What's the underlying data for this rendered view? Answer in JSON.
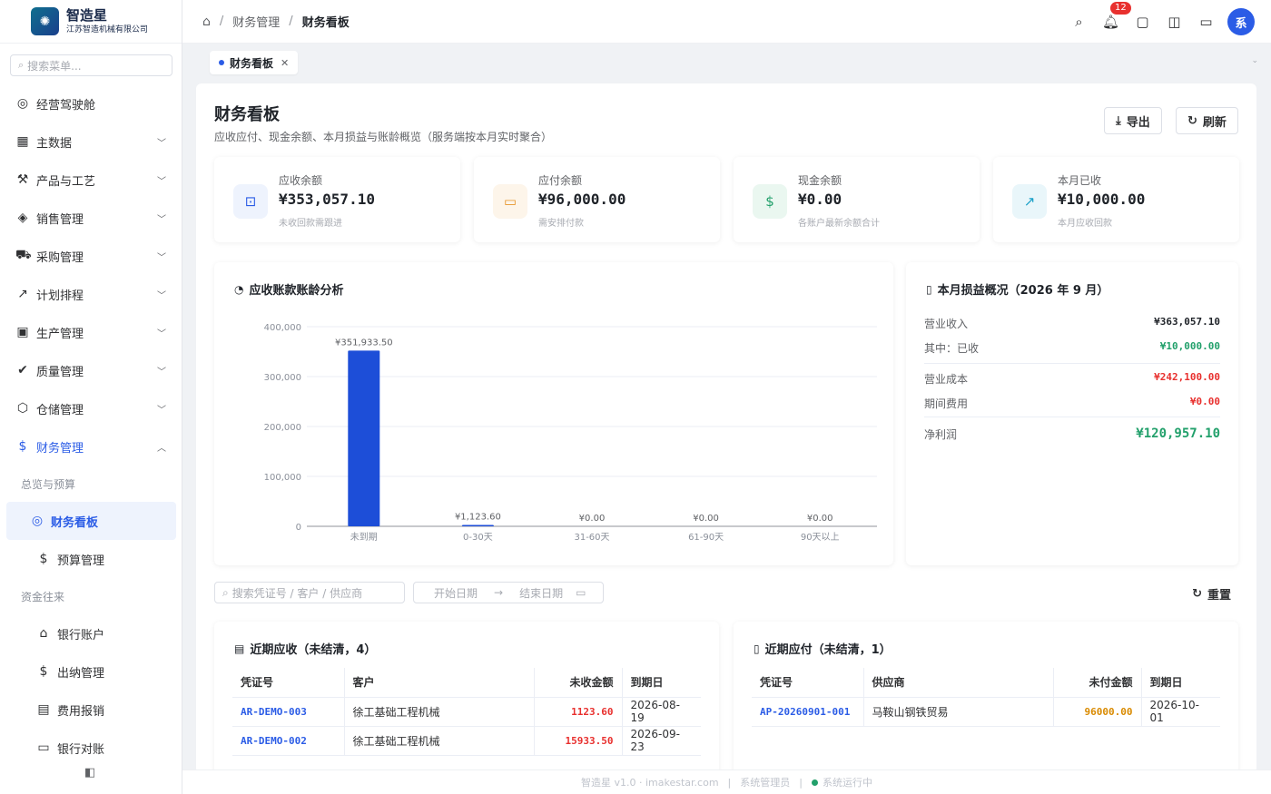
{
  "brand": {
    "name": "智造星",
    "company": "江苏智造机械有限公司"
  },
  "sidebar": {
    "search_placeholder": "搜索菜单...",
    "items": [
      {
        "label": "经营驾驶舱",
        "icon": "gauge-icon",
        "glyph": "◎"
      },
      {
        "label": "主数据",
        "icon": "grid-icon",
        "glyph": "▦"
      },
      {
        "label": "产品与工艺",
        "icon": "tool-icon",
        "glyph": "⚒"
      },
      {
        "label": "销售管理",
        "icon": "tag-icon",
        "glyph": "◈"
      },
      {
        "label": "采购管理",
        "icon": "cart-icon",
        "glyph": "⛟"
      },
      {
        "label": "计划排程",
        "icon": "trend-icon",
        "glyph": "↗"
      },
      {
        "label": "生产管理",
        "icon": "chip-icon",
        "glyph": "▣"
      },
      {
        "label": "质量管理",
        "icon": "check-circle-icon",
        "glyph": "✔"
      },
      {
        "label": "仓储管理",
        "icon": "box-icon",
        "glyph": "⬡"
      },
      {
        "label": "财务管理",
        "icon": "dollar-circle-icon",
        "glyph": "$"
      }
    ],
    "group1": "总览与预算",
    "sub1": [
      {
        "label": "财务看板",
        "icon": "gauge-icon",
        "glyph": "◎"
      },
      {
        "label": "预算管理",
        "icon": "dollar-circle-icon",
        "glyph": "$"
      }
    ],
    "group2": "资金往来",
    "sub2": [
      {
        "label": "银行账户",
        "icon": "bank-icon",
        "glyph": "⌂"
      },
      {
        "label": "出纳管理",
        "icon": "dollar-circle-icon",
        "glyph": "$"
      },
      {
        "label": "费用报销",
        "icon": "receipt-icon",
        "glyph": "▤"
      },
      {
        "label": "银行对账",
        "icon": "card-icon",
        "glyph": "▭"
      }
    ]
  },
  "header": {
    "crumb_parent": "财务管理",
    "crumb_current": "财务看板",
    "notification_count": "12",
    "avatar_text": "系"
  },
  "tab": {
    "label": "财务看板"
  },
  "page": {
    "title": "财务看板",
    "subtitle": "应收应付、现金余额、本月损益与账龄概览（服务端按本月实时聚合）",
    "export_label": "导出",
    "refresh_label": "刷新"
  },
  "kpis": [
    {
      "label": "应收余额",
      "value": "¥353,057.10",
      "note": "未收回款需跟进",
      "icon": "wallet-icon",
      "color": "#2b5ce6",
      "bg": "#eef3fd"
    },
    {
      "label": "应付余额",
      "value": "¥96,000.00",
      "note": "需安排付款",
      "icon": "card-icon",
      "color": "#e6962b",
      "bg": "#fdf5ea"
    },
    {
      "label": "现金余额",
      "value": "¥0.00",
      "note": "各账户最新余额合计",
      "icon": "cash-icon",
      "color": "#22a06b",
      "bg": "#eaf7f0"
    },
    {
      "label": "本月已收",
      "value": "¥10,000.00",
      "note": "本月应收回款",
      "icon": "trend-icon",
      "color": "#1aa0c8",
      "bg": "#e9f6fa"
    }
  ],
  "aging": {
    "title": "应收账款账龄分析"
  },
  "chart_data": {
    "type": "bar",
    "categories": [
      "未到期",
      "0-30天",
      "31-60天",
      "61-90天",
      "90天以上"
    ],
    "values": [
      351933.5,
      1123.6,
      0,
      0,
      0
    ],
    "data_labels": [
      "¥351,933.50",
      "¥1,123.60",
      "¥0.00",
      "¥0.00",
      "¥0.00"
    ],
    "yticks": [
      "400,000",
      "300,000",
      "200,000",
      "100,000",
      "0"
    ],
    "ylim": [
      0,
      400000
    ],
    "grid": true,
    "bar_color": "#1d4ed8"
  },
  "pl": {
    "title": "本月损益概况（2026 年 9 月）",
    "rows": [
      {
        "label": "营业收入",
        "value": "¥363,057.10",
        "color": "#1f2329"
      },
      {
        "label": "其中：已收",
        "value": "¥10,000.00",
        "color": "#22a06b"
      },
      {
        "label": "营业成本",
        "value": "¥242,100.00",
        "color": "#e8302e"
      },
      {
        "label": "期间费用",
        "value": "¥0.00",
        "color": "#e8302e"
      }
    ],
    "net_label": "净利润",
    "net_value": "¥120,957.10"
  },
  "filters": {
    "search_placeholder": "搜索凭证号 / 客户 / 供应商",
    "start_placeholder": "开始日期",
    "end_placeholder": "结束日期",
    "reset_label": "重置"
  },
  "receivables": {
    "title": "近期应收（未结清，4）",
    "headers": [
      "凭证号",
      "客户",
      "未收金额",
      "到期日"
    ],
    "rows": [
      {
        "code": "AR-DEMO-003",
        "party": "徐工基础工程机械",
        "amount": "1123.60",
        "due": "2026-08-19"
      },
      {
        "code": "AR-DEMO-002",
        "party": "徐工基础工程机械",
        "amount": "15933.50",
        "due": "2026-09-23"
      }
    ]
  },
  "payables": {
    "title": "近期应付（未结清，1）",
    "headers": [
      "凭证号",
      "供应商",
      "未付金额",
      "到期日"
    ],
    "rows": [
      {
        "code": "AP-20260901-001",
        "party": "马鞍山钢铁贸易",
        "amount": "96000.00",
        "due": "2026-10-01"
      }
    ]
  },
  "footer": {
    "version": "智造星 v1.0 · imakestar.com",
    "user": "系统管理员",
    "status": "系统运行中"
  }
}
